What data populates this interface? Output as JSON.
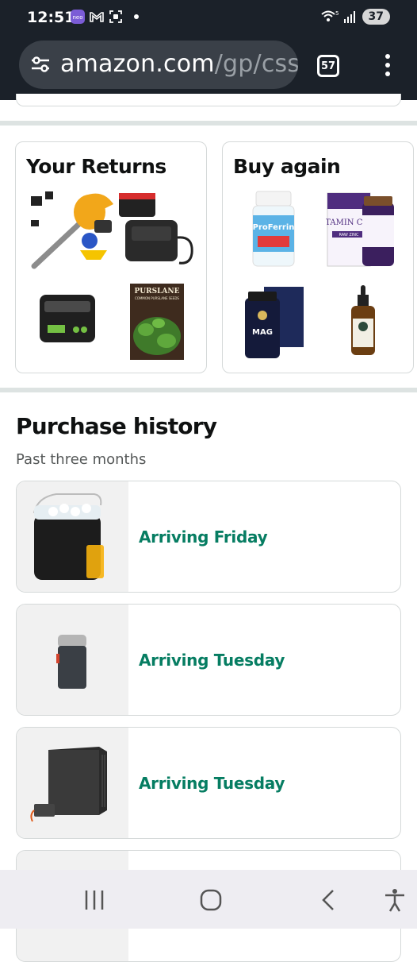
{
  "status_bar": {
    "time": "12:51",
    "battery": "37",
    "signal_label": "5"
  },
  "browser": {
    "url_host": "amazon.com",
    "url_path": "/gp/css/(",
    "tab_count": "57"
  },
  "cards": {
    "returns_title": "Your Returns",
    "buy_again_title": "Buy again"
  },
  "purchase_history": {
    "title": "Purchase history",
    "subtitle": "Past three months",
    "orders": [
      {
        "status": "Arriving Friday",
        "product_icon": "ice-maker"
      },
      {
        "status": "Arriving Tuesday",
        "product_icon": "coffee-grinder"
      },
      {
        "status": "Arriving Tuesday",
        "product_icon": "pc-case"
      }
    ]
  },
  "product_labels": {
    "seed_packet": "PURSLANE",
    "seed_sub": "COMMON PURSLANE SEEDS",
    "supplement_a": "ProFerrin",
    "supplement_b": "VITAMIN CODE",
    "supplement_b_sub": "RAW ZINC",
    "supplement_c": "MAG"
  },
  "colors": {
    "accent_green": "#067d62",
    "status_bar_bg": "#1b2129"
  }
}
